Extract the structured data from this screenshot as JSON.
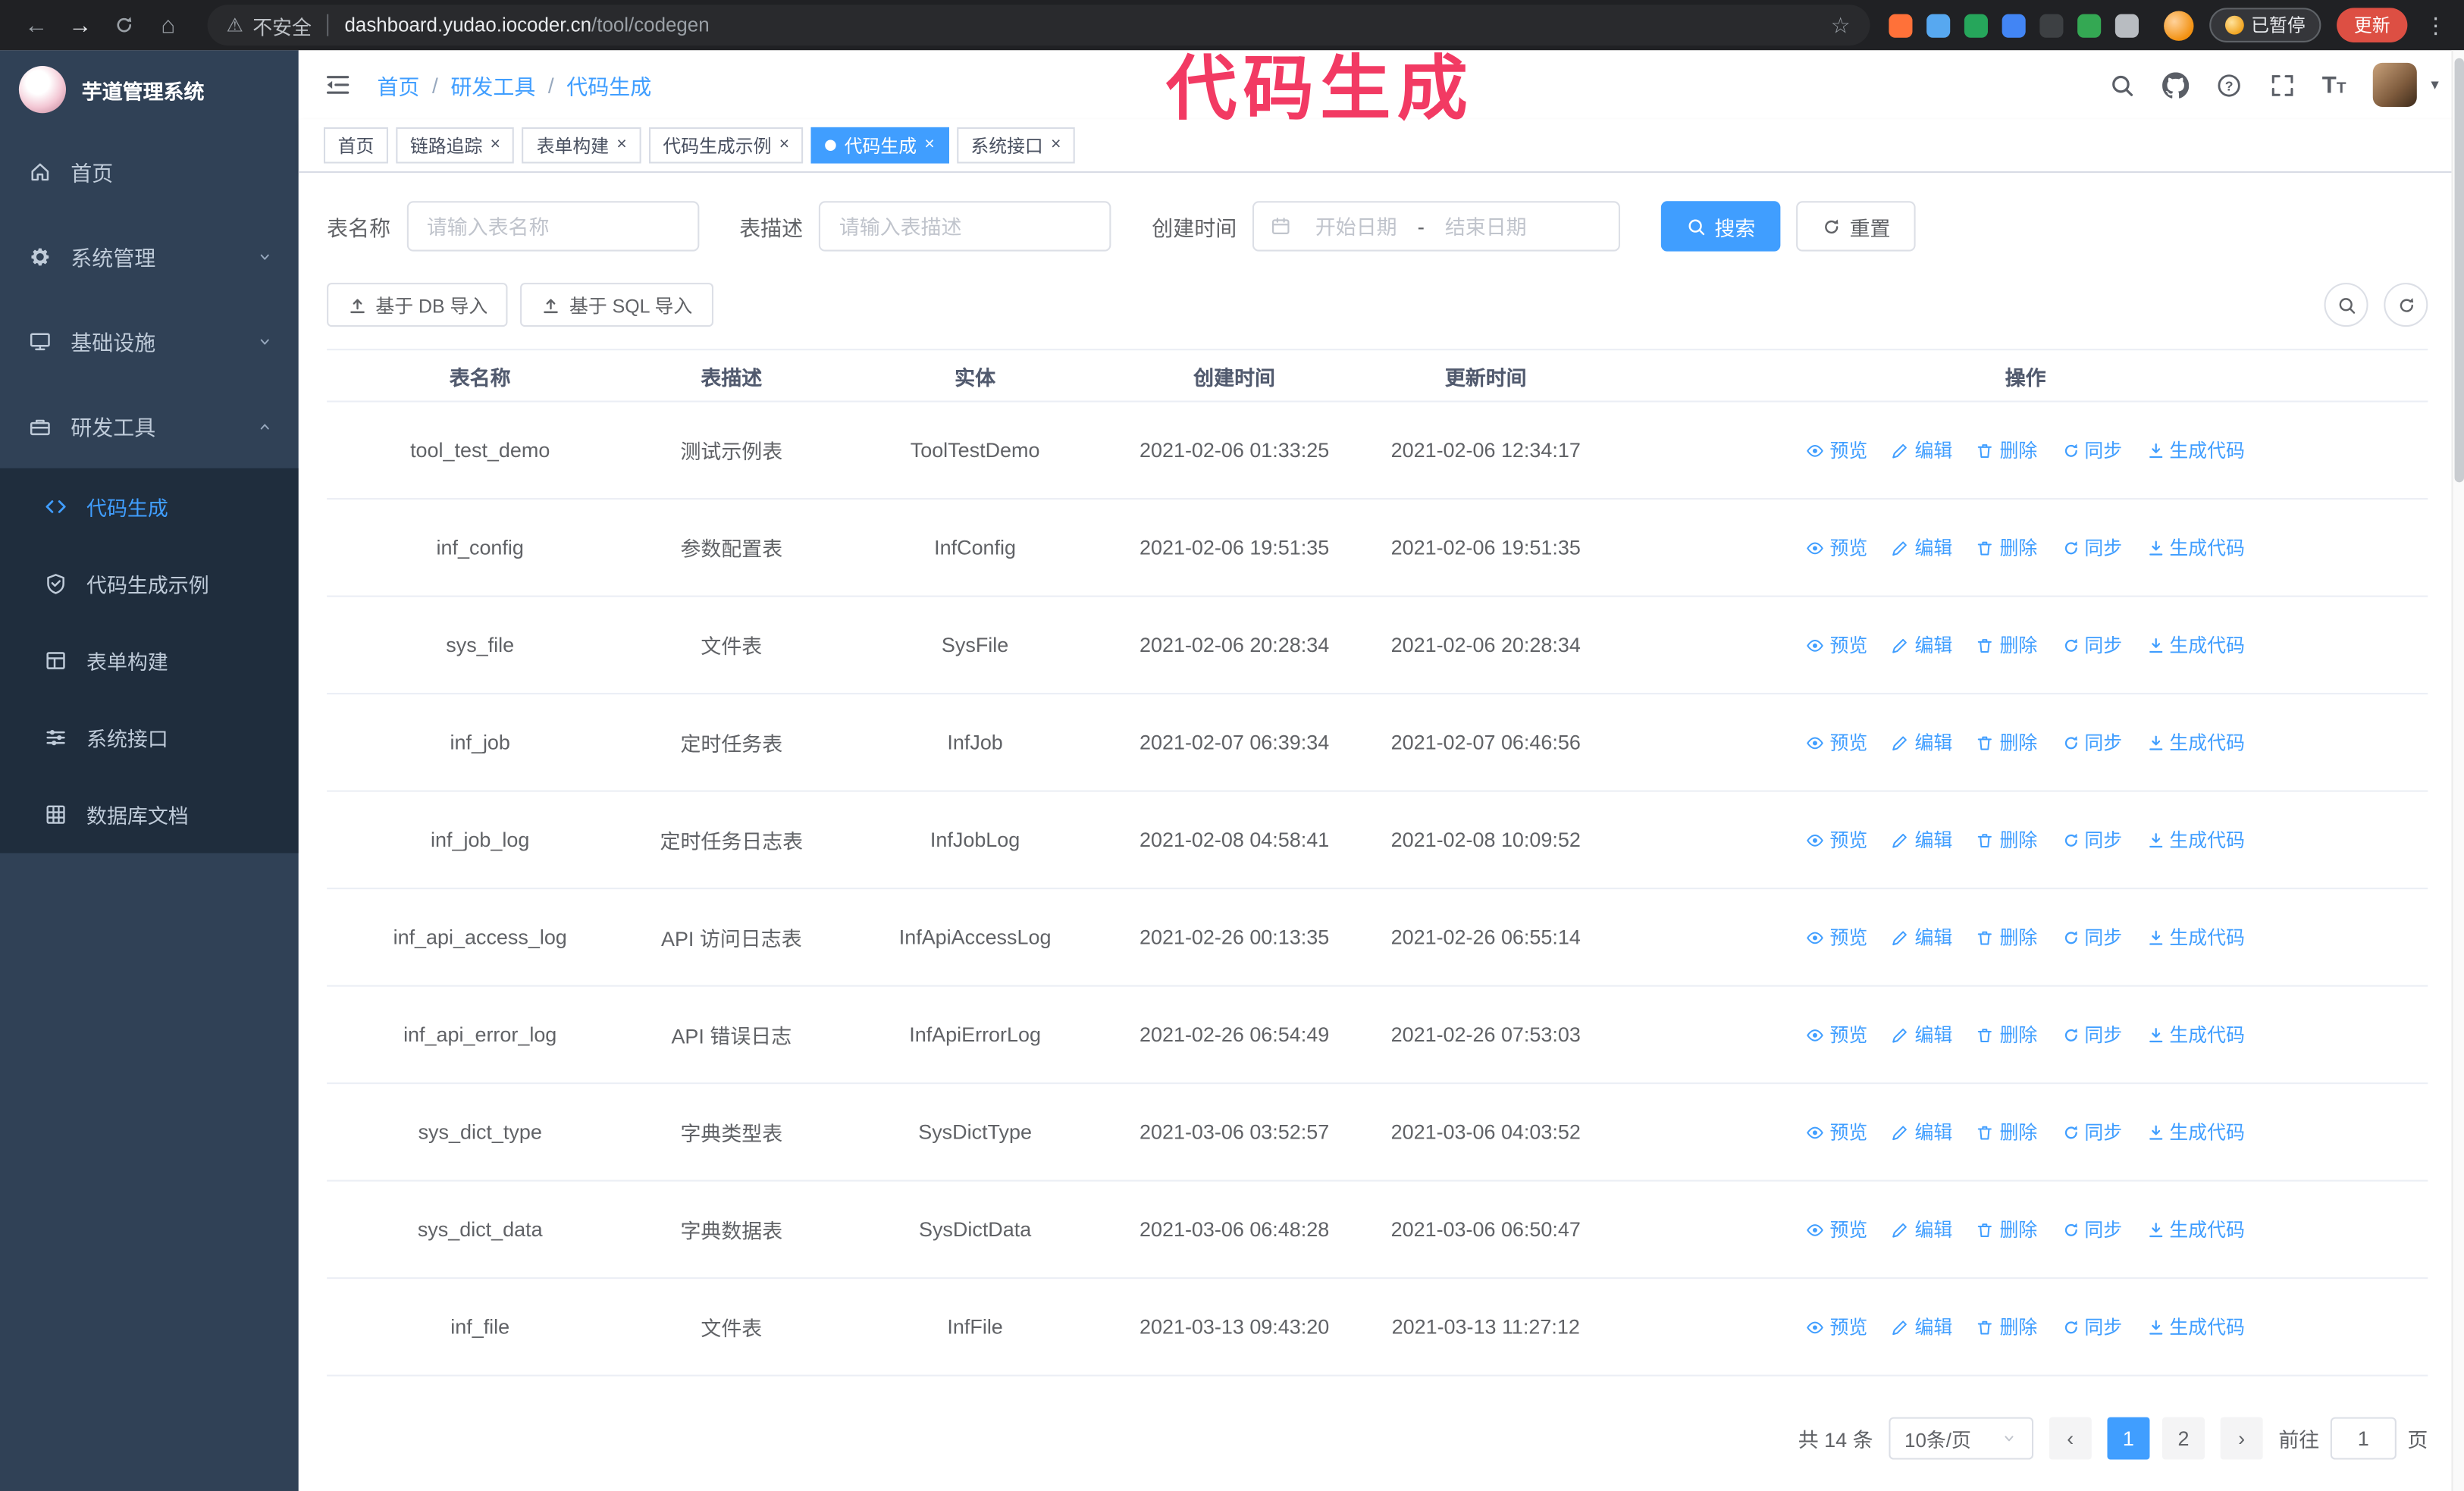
{
  "colors": {
    "accent": "#409eff",
    "annotation": "#f23a63",
    "sidebar_bg": "#304156",
    "submenu_bg": "#1f2d3d",
    "browser_bar": "#202124",
    "update_button": "#dd4f43"
  },
  "browser": {
    "security_label": "不安全",
    "url_host": "dashboard.yudao.iocoder.cn",
    "url_path": "/tool/codegen",
    "paused_badge": "已暂停",
    "update_label": "更新",
    "extension_colors": [
      "#ff7139",
      "#57a8f0",
      "#26a65b",
      "#4285f4",
      "#3d4043",
      "#34a853",
      "#b8bcc1"
    ]
  },
  "annotation": {
    "text": "代码生成"
  },
  "sidebar": {
    "logo_title": "芋道管理系统",
    "items": [
      {
        "label": "首页"
      },
      {
        "label": "系统管理"
      },
      {
        "label": "基础设施"
      },
      {
        "label": "研发工具"
      }
    ],
    "sub_items": [
      {
        "label": "代码生成"
      },
      {
        "label": "代码生成示例"
      },
      {
        "label": "表单构建"
      },
      {
        "label": "系统接口"
      },
      {
        "label": "数据库文档"
      }
    ]
  },
  "header": {
    "breadcrumb": [
      "首页",
      "研发工具",
      "代码生成"
    ],
    "separator": "/"
  },
  "tabs": [
    {
      "label": "首页",
      "closable": false,
      "active": false
    },
    {
      "label": "链路追踪",
      "closable": true,
      "active": false
    },
    {
      "label": "表单构建",
      "closable": true,
      "active": false
    },
    {
      "label": "代码生成示例",
      "closable": true,
      "active": false
    },
    {
      "label": "代码生成",
      "closable": true,
      "active": true
    },
    {
      "label": "系统接口",
      "closable": true,
      "active": false
    }
  ],
  "filters": {
    "table_name_label": "表名称",
    "table_name_placeholder": "请输入表名称",
    "table_desc_label": "表描述",
    "table_desc_placeholder": "请输入表描述",
    "create_time_label": "创建时间",
    "date_start_placeholder": "开始日期",
    "date_separator": "-",
    "date_end_placeholder": "结束日期",
    "search_button": "搜索",
    "reset_button": "重置"
  },
  "toolbar": {
    "import_db_label": "基于 DB 导入",
    "import_sql_label": "基于 SQL 导入"
  },
  "table": {
    "columns": [
      "表名称",
      "表描述",
      "实体",
      "创建时间",
      "更新时间",
      "操作"
    ],
    "actions": [
      "预览",
      "编辑",
      "删除",
      "同步",
      "生成代码"
    ],
    "rows": [
      {
        "name": "tool_test_demo",
        "desc": "测试示例表",
        "entity": "ToolTestDemo",
        "created": "2021-02-06 01:33:25",
        "updated": "2021-02-06 12:34:17"
      },
      {
        "name": "inf_config",
        "desc": "参数配置表",
        "entity": "InfConfig",
        "created": "2021-02-06 19:51:35",
        "updated": "2021-02-06 19:51:35"
      },
      {
        "name": "sys_file",
        "desc": "文件表",
        "entity": "SysFile",
        "created": "2021-02-06 20:28:34",
        "updated": "2021-02-06 20:28:34"
      },
      {
        "name": "inf_job",
        "desc": "定时任务表",
        "entity": "InfJob",
        "created": "2021-02-07 06:39:34",
        "updated": "2021-02-07 06:46:56"
      },
      {
        "name": "inf_job_log",
        "desc": "定时任务日志表",
        "entity": "InfJobLog",
        "created": "2021-02-08 04:58:41",
        "updated": "2021-02-08 10:09:52"
      },
      {
        "name": "inf_api_access_log",
        "desc": "API 访问日志表",
        "entity": "InfApiAccessLog",
        "created": "2021-02-26 00:13:35",
        "updated": "2021-02-26 06:55:14"
      },
      {
        "name": "inf_api_error_log",
        "desc": "API 错误日志",
        "entity": "InfApiErrorLog",
        "created": "2021-02-26 06:54:49",
        "updated": "2021-02-26 07:53:03"
      },
      {
        "name": "sys_dict_type",
        "desc": "字典类型表",
        "entity": "SysDictType",
        "created": "2021-03-06 03:52:57",
        "updated": "2021-03-06 04:03:52"
      },
      {
        "name": "sys_dict_data",
        "desc": "字典数据表",
        "entity": "SysDictData",
        "created": "2021-03-06 06:48:28",
        "updated": "2021-03-06 06:50:47"
      },
      {
        "name": "inf_file",
        "desc": "文件表",
        "entity": "InfFile",
        "created": "2021-03-13 09:43:20",
        "updated": "2021-03-13 11:27:12"
      }
    ]
  },
  "pagination": {
    "total_label": "共 14 条",
    "page_size_label": "10条/页",
    "pages": [
      "1",
      "2"
    ],
    "active_page": "1",
    "goto_label": "前往",
    "goto_value": "1",
    "page_unit": "页"
  }
}
